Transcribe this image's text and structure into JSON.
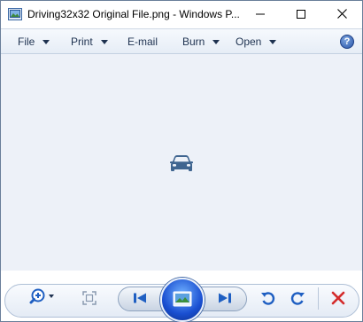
{
  "window": {
    "title": "Driving32x32 Original File.png - Windows P...",
    "app_icon": "photo-viewer-icon"
  },
  "caption_buttons": {
    "minimize_icon": "minimize-icon",
    "maximize_icon": "maximize-icon",
    "close_icon": "close-icon"
  },
  "menubar": {
    "file": "File",
    "print": "Print",
    "email": "E-mail",
    "burn": "Burn",
    "open": "Open",
    "help_glyph": "?"
  },
  "viewer": {
    "image_icon": "car-icon",
    "background_color": "#edf1f8",
    "image_color": "#3f6590"
  },
  "controls": {
    "zoom_icon": "zoom-icon",
    "fit_icon": "actual-size-icon",
    "previous_icon": "previous-icon",
    "slideshow_icon": "slideshow-icon",
    "next_icon": "next-icon",
    "rotate_ccw_icon": "rotate-counterclockwise-icon",
    "rotate_cw_icon": "rotate-clockwise-icon",
    "delete_icon": "delete-icon",
    "accent_color": "#1f5fc2",
    "delete_color": "#d42b2b"
  }
}
